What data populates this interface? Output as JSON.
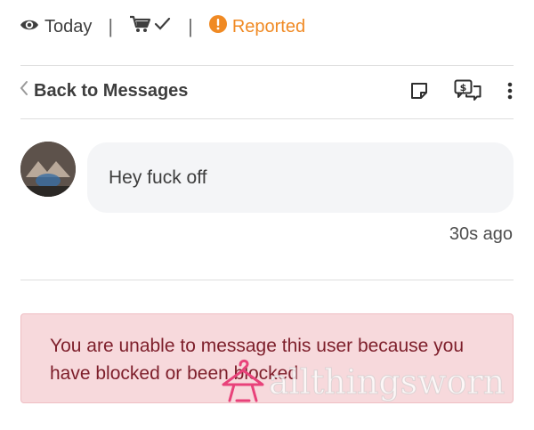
{
  "topbar": {
    "views_icon": "eye-icon",
    "views_label": "Today",
    "order_icon": "cart-check-icon",
    "separator": "|",
    "status_icon": "alert-circle-icon",
    "status_label": "Reported",
    "status_color": "#f08a24"
  },
  "nav": {
    "back_label": "Back to Messages",
    "icons": [
      "note-icon",
      "offer-chat-icon",
      "more-vertical-icon"
    ]
  },
  "message": {
    "text": "Hey fuck off",
    "time": "30s ago"
  },
  "alert": {
    "text": "You are unable to message this user because you have blocked or been blocked",
    "bg_color": "#f7d9dc",
    "text_color": "#7d1e2a"
  },
  "watermark": {
    "text": "allthingsworn",
    "logo_color": "#e8427a"
  }
}
